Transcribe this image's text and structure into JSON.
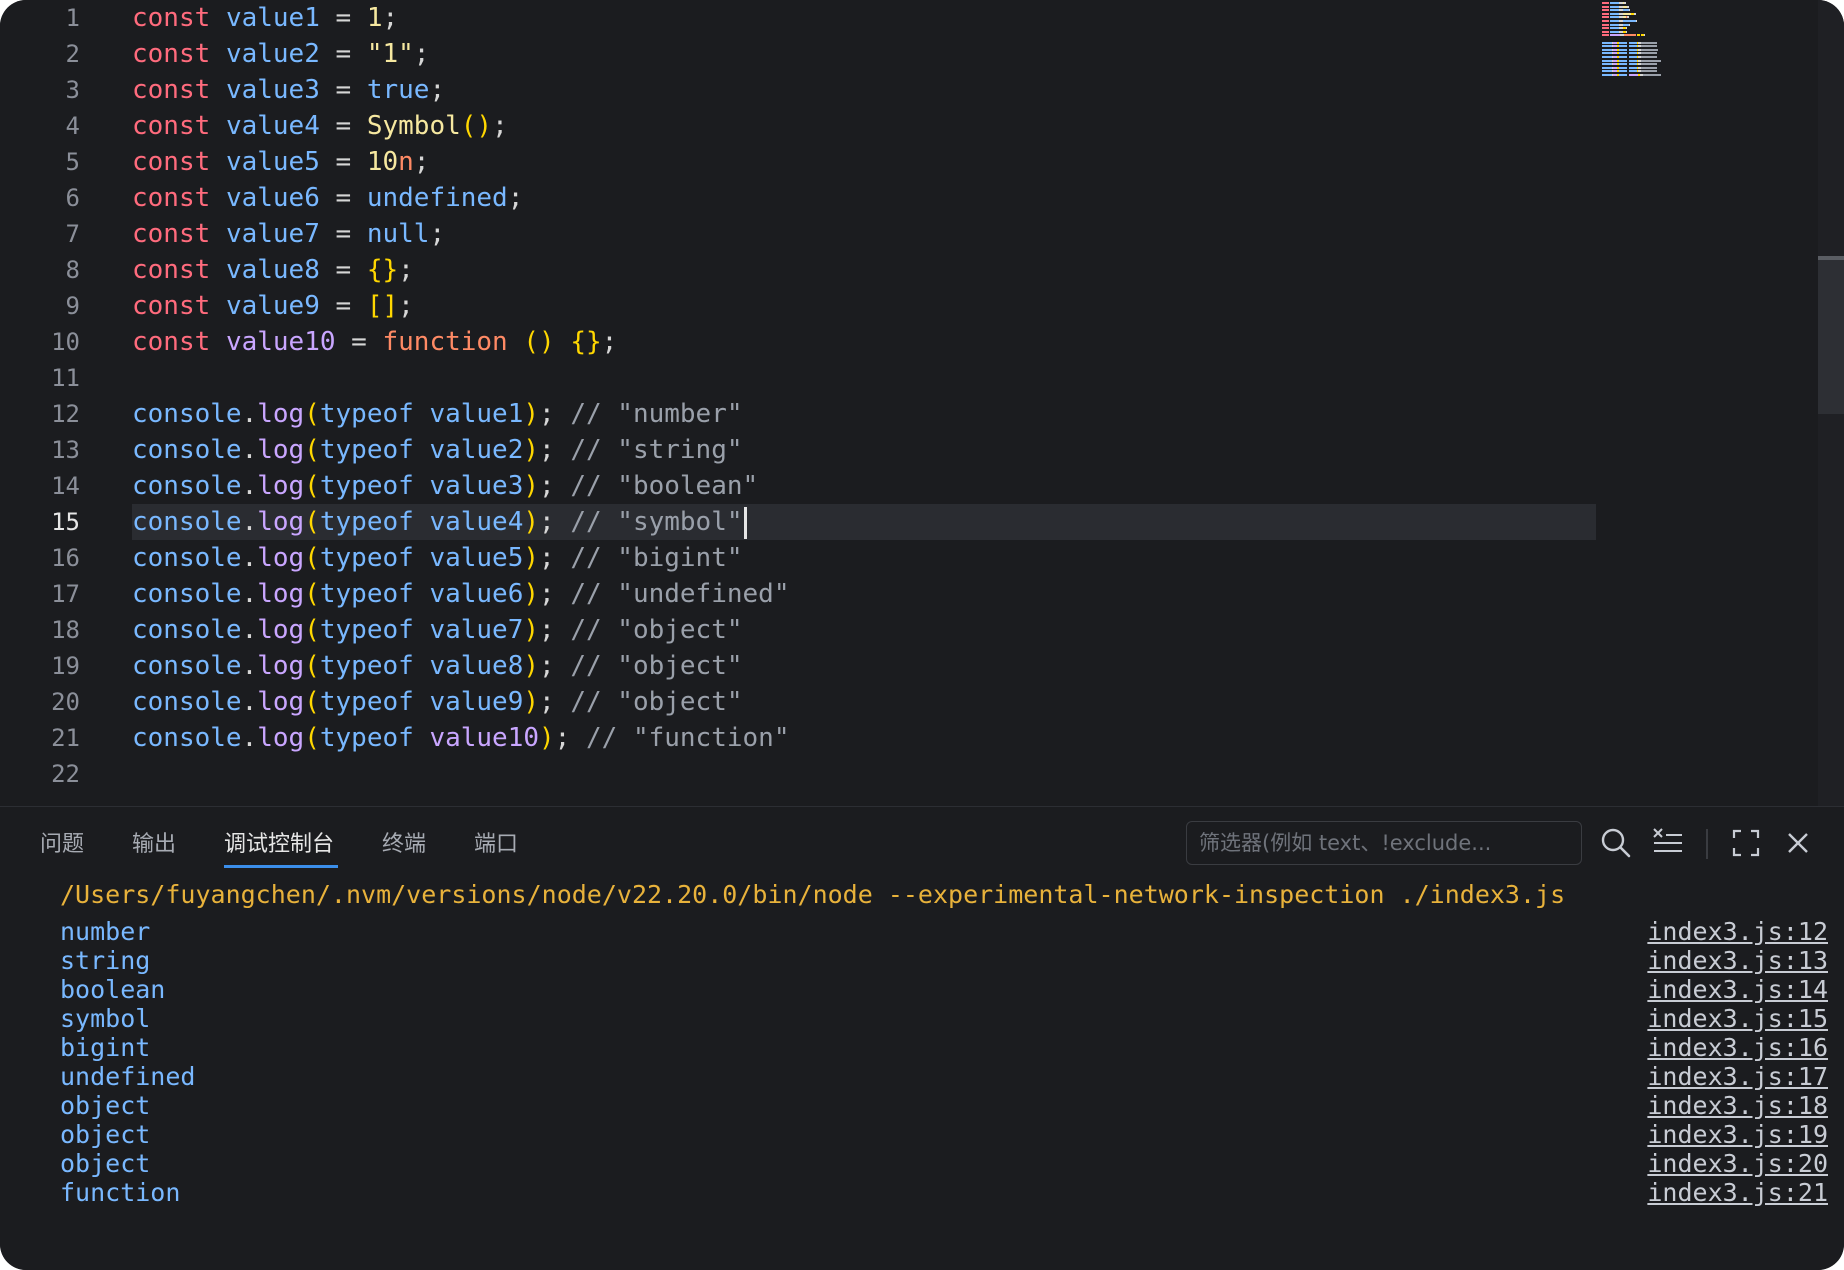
{
  "editor": {
    "active_line": 15,
    "lines": [
      [
        {
          "t": "const",
          "c": "kw"
        },
        {
          "t": " "
        },
        {
          "t": "value1",
          "c": "var"
        },
        {
          "t": " = ",
          "c": "op"
        },
        {
          "t": "1",
          "c": "num"
        },
        {
          "t": ";",
          "c": "op"
        }
      ],
      [
        {
          "t": "const",
          "c": "kw"
        },
        {
          "t": " "
        },
        {
          "t": "value2",
          "c": "var"
        },
        {
          "t": " = ",
          "c": "op"
        },
        {
          "t": "\"1\"",
          "c": "str"
        },
        {
          "t": ";",
          "c": "op"
        }
      ],
      [
        {
          "t": "const",
          "c": "kw"
        },
        {
          "t": " "
        },
        {
          "t": "value3",
          "c": "var"
        },
        {
          "t": " = ",
          "c": "op"
        },
        {
          "t": "true",
          "c": "lit"
        },
        {
          "t": ";",
          "c": "op"
        }
      ],
      [
        {
          "t": "const",
          "c": "kw"
        },
        {
          "t": " "
        },
        {
          "t": "value4",
          "c": "var"
        },
        {
          "t": " = ",
          "c": "op"
        },
        {
          "t": "Symbol",
          "c": "fn"
        },
        {
          "t": "()",
          "c": "pn"
        },
        {
          "t": ";",
          "c": "op"
        }
      ],
      [
        {
          "t": "const",
          "c": "kw"
        },
        {
          "t": " "
        },
        {
          "t": "value5",
          "c": "var"
        },
        {
          "t": " = ",
          "c": "op"
        },
        {
          "t": "10",
          "c": "num"
        },
        {
          "t": "n",
          "c": "bign"
        },
        {
          "t": ";",
          "c": "op"
        }
      ],
      [
        {
          "t": "const",
          "c": "kw"
        },
        {
          "t": " "
        },
        {
          "t": "value6",
          "c": "var"
        },
        {
          "t": " = ",
          "c": "op"
        },
        {
          "t": "undefined",
          "c": "lit"
        },
        {
          "t": ";",
          "c": "op"
        }
      ],
      [
        {
          "t": "const",
          "c": "kw"
        },
        {
          "t": " "
        },
        {
          "t": "value7",
          "c": "var"
        },
        {
          "t": " = ",
          "c": "op"
        },
        {
          "t": "null",
          "c": "lit"
        },
        {
          "t": ";",
          "c": "op"
        }
      ],
      [
        {
          "t": "const",
          "c": "kw"
        },
        {
          "t": " "
        },
        {
          "t": "value8",
          "c": "var"
        },
        {
          "t": " = ",
          "c": "op"
        },
        {
          "t": "{}",
          "c": "pn"
        },
        {
          "t": ";",
          "c": "op"
        }
      ],
      [
        {
          "t": "const",
          "c": "kw"
        },
        {
          "t": " "
        },
        {
          "t": "value9",
          "c": "var"
        },
        {
          "t": " = ",
          "c": "op"
        },
        {
          "t": "[]",
          "c": "pn"
        },
        {
          "t": ";",
          "c": "op"
        }
      ],
      [
        {
          "t": "const",
          "c": "kw"
        },
        {
          "t": " "
        },
        {
          "t": "value10",
          "c": "arg10"
        },
        {
          "t": " = ",
          "c": "op"
        },
        {
          "t": "function",
          "c": "funckw"
        },
        {
          "t": " "
        },
        {
          "t": "()",
          "c": "pn"
        },
        {
          "t": " "
        },
        {
          "t": "{}",
          "c": "pn"
        },
        {
          "t": ";",
          "c": "op"
        }
      ],
      [],
      [
        {
          "t": "console",
          "c": "var"
        },
        {
          "t": ".",
          "c": "op"
        },
        {
          "t": "log",
          "c": "method"
        },
        {
          "t": "(",
          "c": "pn"
        },
        {
          "t": "typeof",
          "c": "tof"
        },
        {
          "t": " "
        },
        {
          "t": "value1",
          "c": "var"
        },
        {
          "t": ")",
          "c": "pn"
        },
        {
          "t": "; ",
          "c": "op"
        },
        {
          "t": "// \"number\"",
          "c": "cm"
        }
      ],
      [
        {
          "t": "console",
          "c": "var"
        },
        {
          "t": ".",
          "c": "op"
        },
        {
          "t": "log",
          "c": "method"
        },
        {
          "t": "(",
          "c": "pn"
        },
        {
          "t": "typeof",
          "c": "tof"
        },
        {
          "t": " "
        },
        {
          "t": "value2",
          "c": "var"
        },
        {
          "t": ")",
          "c": "pn"
        },
        {
          "t": "; ",
          "c": "op"
        },
        {
          "t": "// \"string\"",
          "c": "cm"
        }
      ],
      [
        {
          "t": "console",
          "c": "var"
        },
        {
          "t": ".",
          "c": "op"
        },
        {
          "t": "log",
          "c": "method"
        },
        {
          "t": "(",
          "c": "pn"
        },
        {
          "t": "typeof",
          "c": "tof"
        },
        {
          "t": " "
        },
        {
          "t": "value3",
          "c": "var"
        },
        {
          "t": ")",
          "c": "pn"
        },
        {
          "t": "; ",
          "c": "op"
        },
        {
          "t": "// \"boolean\"",
          "c": "cm"
        }
      ],
      [
        {
          "t": "console",
          "c": "var"
        },
        {
          "t": ".",
          "c": "op"
        },
        {
          "t": "log",
          "c": "method"
        },
        {
          "t": "(",
          "c": "pn"
        },
        {
          "t": "typeof",
          "c": "tof"
        },
        {
          "t": " "
        },
        {
          "t": "value4",
          "c": "var"
        },
        {
          "t": ")",
          "c": "pn"
        },
        {
          "t": "; ",
          "c": "op"
        },
        {
          "t": "// \"symbol\"",
          "c": "cm"
        }
      ],
      [
        {
          "t": "console",
          "c": "var"
        },
        {
          "t": ".",
          "c": "op"
        },
        {
          "t": "log",
          "c": "method"
        },
        {
          "t": "(",
          "c": "pn"
        },
        {
          "t": "typeof",
          "c": "tof"
        },
        {
          "t": " "
        },
        {
          "t": "value5",
          "c": "var"
        },
        {
          "t": ")",
          "c": "pn"
        },
        {
          "t": "; ",
          "c": "op"
        },
        {
          "t": "// \"bigint\"",
          "c": "cm"
        }
      ],
      [
        {
          "t": "console",
          "c": "var"
        },
        {
          "t": ".",
          "c": "op"
        },
        {
          "t": "log",
          "c": "method"
        },
        {
          "t": "(",
          "c": "pn"
        },
        {
          "t": "typeof",
          "c": "tof"
        },
        {
          "t": " "
        },
        {
          "t": "value6",
          "c": "var"
        },
        {
          "t": ")",
          "c": "pn"
        },
        {
          "t": "; ",
          "c": "op"
        },
        {
          "t": "// \"undefined\"",
          "c": "cm"
        }
      ],
      [
        {
          "t": "console",
          "c": "var"
        },
        {
          "t": ".",
          "c": "op"
        },
        {
          "t": "log",
          "c": "method"
        },
        {
          "t": "(",
          "c": "pn"
        },
        {
          "t": "typeof",
          "c": "tof"
        },
        {
          "t": " "
        },
        {
          "t": "value7",
          "c": "var"
        },
        {
          "t": ")",
          "c": "pn"
        },
        {
          "t": "; ",
          "c": "op"
        },
        {
          "t": "// \"object\"",
          "c": "cm"
        }
      ],
      [
        {
          "t": "console",
          "c": "var"
        },
        {
          "t": ".",
          "c": "op"
        },
        {
          "t": "log",
          "c": "method"
        },
        {
          "t": "(",
          "c": "pn"
        },
        {
          "t": "typeof",
          "c": "tof"
        },
        {
          "t": " "
        },
        {
          "t": "value8",
          "c": "var"
        },
        {
          "t": ")",
          "c": "pn"
        },
        {
          "t": "; ",
          "c": "op"
        },
        {
          "t": "// \"object\"",
          "c": "cm"
        }
      ],
      [
        {
          "t": "console",
          "c": "var"
        },
        {
          "t": ".",
          "c": "op"
        },
        {
          "t": "log",
          "c": "method"
        },
        {
          "t": "(",
          "c": "pn"
        },
        {
          "t": "typeof",
          "c": "tof"
        },
        {
          "t": " "
        },
        {
          "t": "value9",
          "c": "var"
        },
        {
          "t": ")",
          "c": "pn"
        },
        {
          "t": "; ",
          "c": "op"
        },
        {
          "t": "// \"object\"",
          "c": "cm"
        }
      ],
      [
        {
          "t": "console",
          "c": "var"
        },
        {
          "t": ".",
          "c": "op"
        },
        {
          "t": "log",
          "c": "method"
        },
        {
          "t": "(",
          "c": "pn"
        },
        {
          "t": "typeof",
          "c": "tof"
        },
        {
          "t": " "
        },
        {
          "t": "value10",
          "c": "arg10"
        },
        {
          "t": ")",
          "c": "pn"
        },
        {
          "t": "; ",
          "c": "op"
        },
        {
          "t": "// \"function\"",
          "c": "cm"
        }
      ],
      []
    ]
  },
  "panel": {
    "tabs": [
      {
        "label": "问题",
        "active": false
      },
      {
        "label": "输出",
        "active": false
      },
      {
        "label": "调试控制台",
        "active": true
      },
      {
        "label": "终端",
        "active": false
      },
      {
        "label": "端口",
        "active": false
      }
    ],
    "filter_placeholder": "筛选器(例如 text、!exclude...",
    "tools": [
      "search-icon",
      "clear-console-icon",
      "maximize-icon",
      "close-icon"
    ],
    "command": "/Users/fuyangchen/.nvm/versions/node/v22.20.0/bin/node --experimental-network-inspection ./index3.js",
    "outputs": [
      {
        "text": "number",
        "source": "index3.js:12"
      },
      {
        "text": "string",
        "source": "index3.js:13"
      },
      {
        "text": "boolean",
        "source": "index3.js:14"
      },
      {
        "text": "symbol",
        "source": "index3.js:15"
      },
      {
        "text": "bigint",
        "source": "index3.js:16"
      },
      {
        "text": "undefined",
        "source": "index3.js:17"
      },
      {
        "text": "object",
        "source": "index3.js:18"
      },
      {
        "text": "object",
        "source": "index3.js:19"
      },
      {
        "text": "object",
        "source": "index3.js:20"
      },
      {
        "text": "function",
        "source": "index3.js:21"
      }
    ]
  },
  "colors": {
    "background": "#1b1c1f",
    "keyword": "#ff6b7d",
    "identifier": "#79b8ff",
    "command": "#e8b23b",
    "accent": "#3b8eea"
  }
}
